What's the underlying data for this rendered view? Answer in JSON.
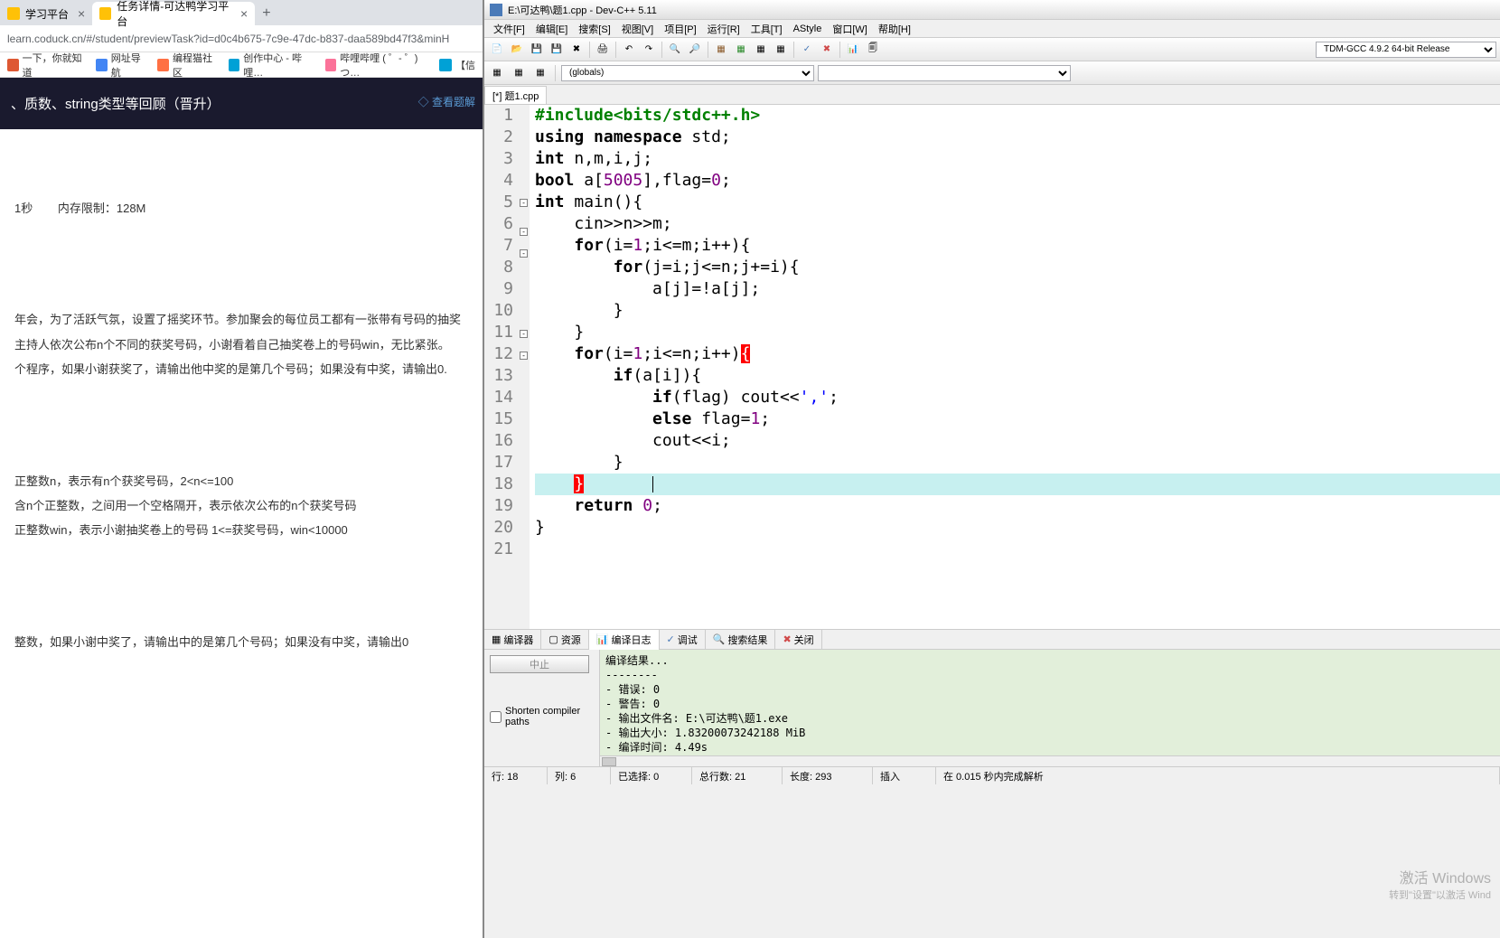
{
  "browser": {
    "tabs": [
      {
        "title": "学习平台"
      },
      {
        "title": "任务详情-可达鸭学习平台"
      }
    ],
    "url": "learn.coduck.cn/#/student/previewTask?id=d0c4b675-7c9e-47dc-b837-daa589bd47f3&minH",
    "bookmarks": [
      {
        "label": "一下，你就知道"
      },
      {
        "label": "网址导航"
      },
      {
        "label": "编程猫社区"
      },
      {
        "label": "创作中心 - 哔哩…"
      },
      {
        "label": "哔哩哔哩 ( ゜- ゜)つ…"
      },
      {
        "label": "【信"
      }
    ]
  },
  "page": {
    "title": "、质数、string类型等回顾（晋升）",
    "view_solution": "◇ 查看题解",
    "time_limit": "1秒",
    "mem_limit_label": "内存限制：128M",
    "desc1": "年会，为了活跃气氛，设置了摇奖环节。参加聚会的每位员工都有一张带有号码的抽奖",
    "desc2": "主持人依次公布n个不同的获奖号码，小谢看着自己抽奖卷上的号码win，无比紧张。",
    "desc3": "个程序，如果小谢获奖了，请输出他中奖的是第几个号码；如果没有中奖，请输出0.",
    "input1": "正整数n，表示有n个获奖号码，2<n<=100",
    "input2": "含n个正整数，之间用一个空格隔开，表示依次公布的n个获奖号码",
    "input3": "正整数win，表示小谢抽奖卷上的号码 1<=获奖号码，win<10000",
    "output1": "整数，如果小谢中奖了，请输出中的是第几个号码；如果没有中奖，请输出0"
  },
  "devcpp": {
    "title": "E:\\可达鸭\\题1.cpp - Dev-C++ 5.11",
    "menus": [
      "文件[F]",
      "编辑[E]",
      "搜索[S]",
      "视图[V]",
      "项目[P]",
      "运行[R]",
      "工具[T]",
      "AStyle",
      "窗口[W]",
      "帮助[H]"
    ],
    "compiler": "TDM-GCC 4.9.2 64-bit Release",
    "globals": "(globals)",
    "file_tab": "[*] 题1.cpp",
    "bottom_tabs": {
      "compiler": "编译器",
      "resources": "资源",
      "compile_log": "编译日志",
      "debug": "调试",
      "search_results": "搜索结果",
      "close": "关闭"
    },
    "abort": "中止",
    "shorten": "Shorten compiler paths",
    "compile_output": {
      "header": "编译结果...",
      "separator": "--------",
      "errors": "- 错误: 0",
      "warnings": "- 警告: 0",
      "output_file": "- 输出文件名: E:\\可达鸭\\题1.exe",
      "output_size": "- 输出大小: 1.83200073242188 MiB",
      "compile_time": "- 编译时间: 4.49s"
    },
    "status": {
      "line": "行:   18",
      "col": "列:   6",
      "sel": "已选择:   0",
      "total": "总行数:   21",
      "length": "长度:   293",
      "insert": "插入",
      "parse": "在 0.015 秒内完成解析"
    }
  },
  "watermark": {
    "title": "激活 Windows",
    "sub": "转到\"设置\"以激活 Wind"
  }
}
